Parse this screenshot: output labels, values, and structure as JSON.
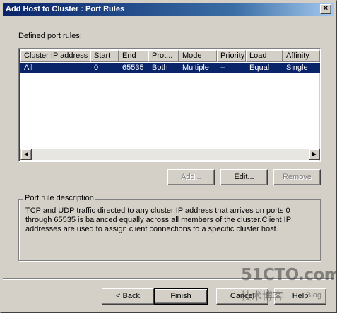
{
  "window": {
    "title": "Add Host to Cluster : Port Rules",
    "close_glyph": "×"
  },
  "defined_rules_label": "Defined port rules:",
  "list": {
    "columns": [
      "Cluster IP address",
      "Start",
      "End",
      "Prot...",
      "Mode",
      "Priority",
      "Load",
      "Affinity"
    ],
    "rows": [
      {
        "cluster_ip": "All",
        "start": "0",
        "end": "65535",
        "protocol": "Both",
        "mode": "Multiple",
        "priority": "--",
        "load": "Equal",
        "affinity": "Single",
        "selected": true
      }
    ],
    "scroll_left_icon": "left-arrow-icon",
    "scroll_right_icon": "right-arrow-icon",
    "scroll_left_glyph": "◀",
    "scroll_right_glyph": "▶"
  },
  "rule_buttons": {
    "add": "Add...",
    "edit": "Edit...",
    "remove": "Remove"
  },
  "description": {
    "title": "Port rule description",
    "text": "TCP and UDP traffic directed to any cluster IP address that arrives on ports 0 through 65535 is balanced equally across all members of the cluster.Client IP addresses are used to assign client connections to a specific cluster host."
  },
  "nav_buttons": {
    "back": "< Back",
    "finish": "Finish",
    "cancel": "Cancel",
    "help": "Help"
  },
  "watermark": {
    "site": "51CTO.com",
    "tagline": "技术博客",
    "blog": "Blog"
  },
  "colors": {
    "face": "#d4d0c8",
    "selection": "#0a246a",
    "title_start": "#0a246a",
    "title_end": "#a6caf0"
  }
}
